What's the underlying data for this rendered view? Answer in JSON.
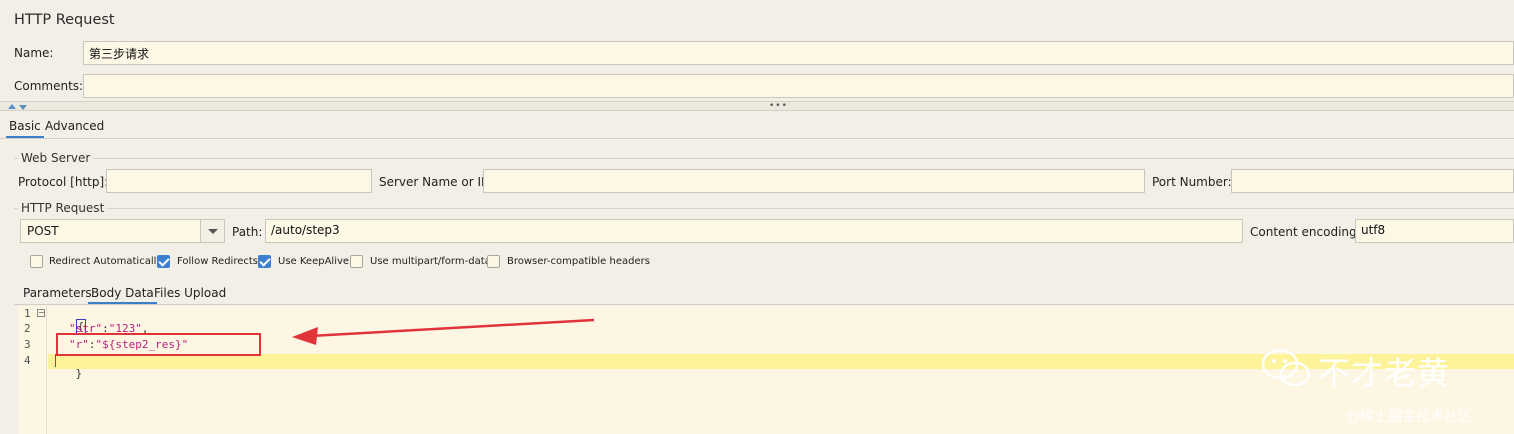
{
  "panel": {
    "title": "HTTP Request",
    "name_label": "Name:",
    "name_value": "第三步请求",
    "comments_label": "Comments:",
    "comments_value": ""
  },
  "tabs": [
    {
      "label": "Basic",
      "active": true
    },
    {
      "label": "Advanced",
      "active": false
    }
  ],
  "web_server": {
    "group_title": "Web Server",
    "protocol_label": "Protocol [http]:",
    "protocol_value": "",
    "server_label": "Server Name or IP:",
    "server_value": "",
    "port_label": "Port Number:",
    "port_value": ""
  },
  "http_request": {
    "group_title": "HTTP Request",
    "method": "POST",
    "path_label": "Path:",
    "path_value": "/auto/step3",
    "encoding_label": "Content encoding:",
    "encoding_value": "utf8"
  },
  "options": [
    {
      "label": "Redirect Automatically",
      "checked": false
    },
    {
      "label": "Follow Redirects",
      "checked": true
    },
    {
      "label": "Use KeepAlive",
      "checked": true
    },
    {
      "label": "Use multipart/form-data",
      "checked": false
    },
    {
      "label": "Browser-compatible headers",
      "checked": false
    }
  ],
  "body_tabs": [
    {
      "label": "Parameters",
      "active": false
    },
    {
      "label": "Body Data",
      "active": true
    },
    {
      "label": "Files Upload",
      "active": false
    }
  ],
  "editor": {
    "line_numbers": [
      "1",
      "2",
      "3",
      "4"
    ],
    "fold_marker": "−",
    "line1": "{",
    "line2_key": "\"str\"",
    "line2_sep": ":",
    "line2_val": "\"123\"",
    "line2_end": ",",
    "line3_key": "\"r\"",
    "line3_sep": ":",
    "line3_val": "\"${step2_res}\"",
    "line4": "}"
  },
  "watermark": {
    "brand": "不才老黄",
    "site": "@稀土掘金技术社区"
  },
  "colors": {
    "accent": "#3d7fd1",
    "annotation": "#e0333a",
    "editor_bg": "#fdf6e3",
    "highlight": "#fdf39b"
  }
}
